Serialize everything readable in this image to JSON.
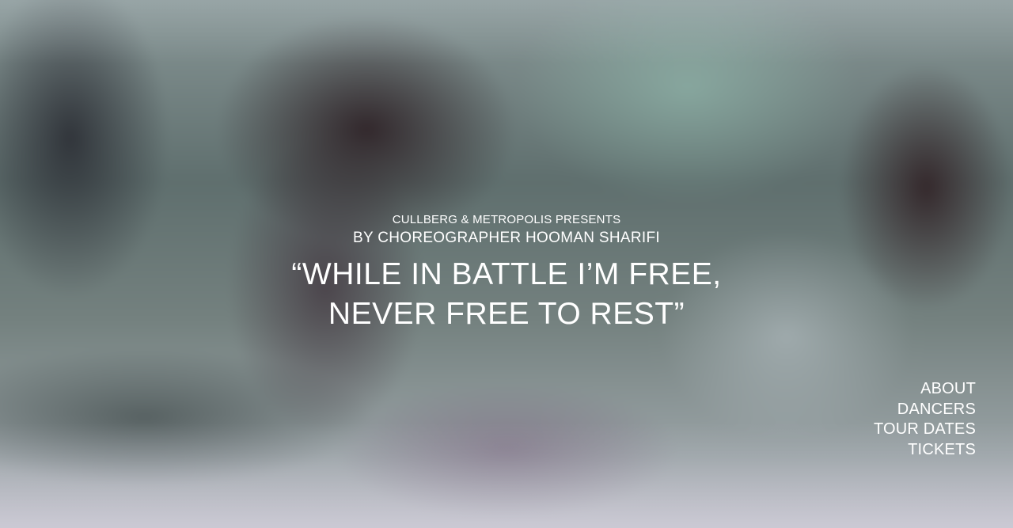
{
  "hero": {
    "presents": "CULLBERG & METROPOLIS PRESENTS",
    "byline": "BY CHOREOGRAPHER HOOMAN SHARIFI",
    "title_line1": "“WHILE IN BATTLE I’M FREE,",
    "title_line2": "NEVER FREE TO REST”"
  },
  "nav": {
    "items": [
      {
        "label": "ABOUT"
      },
      {
        "label": "DANCERS"
      },
      {
        "label": "TOUR DATES"
      },
      {
        "label": "TICKETS"
      }
    ]
  },
  "colors": {
    "text": "#ffffff"
  }
}
